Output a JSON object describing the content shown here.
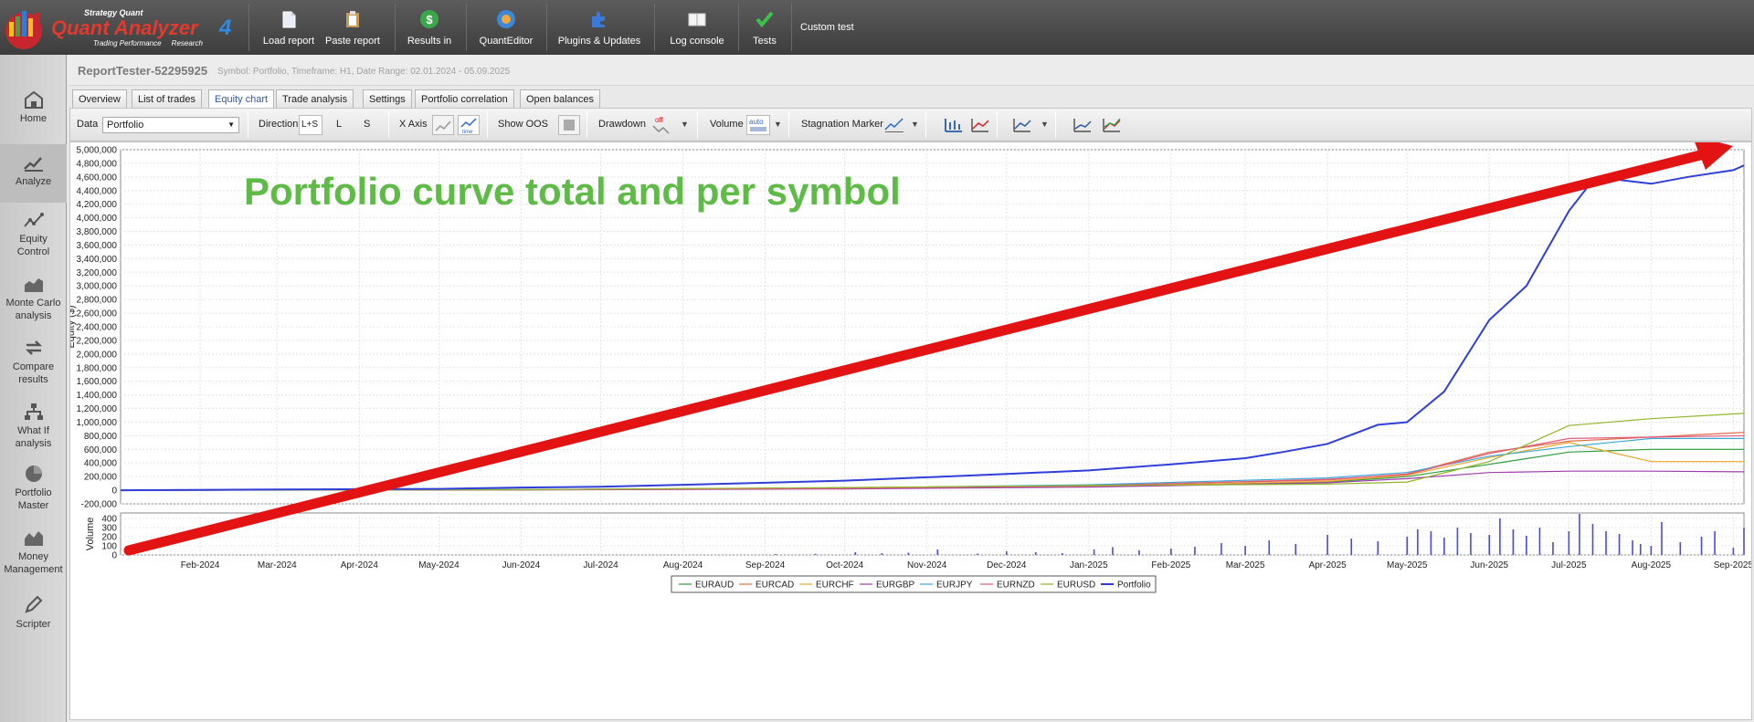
{
  "app": {
    "brand_small": "Strategy Quant",
    "brand_name": "Quant Analyzer",
    "brand_version": "4",
    "brand_tagline": "Trading Performance     Research"
  },
  "toolbar": {
    "items": [
      {
        "label": "Load report",
        "icon": "load-report-icon"
      },
      {
        "label": "Paste report",
        "icon": "paste-report-icon"
      },
      {
        "label": "Results in",
        "icon": "results-in-icon"
      },
      {
        "label": "QuantEditor",
        "icon": "quanteditor-icon"
      },
      {
        "label": "Plugins & Updates",
        "icon": "plugins-icon"
      },
      {
        "label": "Log console",
        "icon": "log-console-icon"
      },
      {
        "label": "Tests",
        "icon": "check-icon"
      }
    ],
    "custom_test_label": "Custom test"
  },
  "sidebar": {
    "items": [
      {
        "label": "Home",
        "icon": "home-icon"
      },
      {
        "label": "Analyze",
        "icon": "analyze-icon"
      },
      {
        "label": "Equity Control",
        "icon": "equity-control-icon"
      },
      {
        "label": "Monte Carlo analysis",
        "icon": "monte-carlo-icon"
      },
      {
        "label": "Compare results",
        "icon": "compare-icon"
      },
      {
        "label": "What If analysis",
        "icon": "what-if-icon"
      },
      {
        "label": "Portfolio Master",
        "icon": "portfolio-master-icon"
      },
      {
        "label": "Money Management",
        "icon": "money-management-icon"
      },
      {
        "label": "Scripter",
        "icon": "scripter-icon"
      }
    ],
    "active": "Analyze"
  },
  "header": {
    "title": "ReportTester-52295925",
    "meta": "Symbol: Portfolio, Timeframe: H1, Date Range: 02.01.2024 - 05.09.2025"
  },
  "tabs": [
    "Overview",
    "List of trades",
    "Equity chart",
    "Trade analysis",
    "Settings",
    "Portfolio correlation",
    "Open balances"
  ],
  "active_tab": "Equity chart",
  "chart_toolbar": {
    "data_label": "Data",
    "data_value": "Portfolio",
    "direction_label": "Direction",
    "direction_options": [
      "L+S",
      "L",
      "S"
    ],
    "xaxis_label": "X Axis",
    "xaxis_time": "time",
    "show_oos_label": "Show OOS",
    "drawdown_label": "Drawdown",
    "drawdown_value": "off",
    "volume_label": "Volume",
    "volume_value": "auto",
    "stagnation_label": "Stagnation Marker"
  },
  "annotation": {
    "text": "Portfolio curve total and per symbol",
    "color": "#5dbb46",
    "arrow_color": "#e41313"
  },
  "chart_data": {
    "type": "line",
    "ylabel": "Equity ($)",
    "y_ticks": [
      5000000,
      4800000,
      4600000,
      4400000,
      4200000,
      4000000,
      3800000,
      3600000,
      3400000,
      3200000,
      3000000,
      2800000,
      2600000,
      2400000,
      2200000,
      2000000,
      1800000,
      1600000,
      1400000,
      1200000,
      1000000,
      800000,
      600000,
      400000,
      200000,
      0,
      -200000
    ],
    "y_tick_labels": [
      "5,000,000",
      "4,800,000",
      "4,600,000",
      "4,400,000",
      "4,200,000",
      "4,000,000",
      "3,800,000",
      "3,600,000",
      "3,400,000",
      "3,200,000",
      "3,000,000",
      "2,800,000",
      "2,600,000",
      "2,400,000",
      "2,200,000",
      "2,000,000",
      "1,800,000",
      "1,600,000",
      "1,400,000",
      "1,200,000",
      "1,000,000",
      "800,000",
      "600,000",
      "400,000",
      "200,000",
      "0",
      "-200,000"
    ],
    "ylim": [
      -200000,
      5000000
    ],
    "x_range": [
      "2024-01-02",
      "2025-09-05"
    ],
    "x_ticks": [
      {
        "date": "2024-02-01",
        "label": "Feb-2024"
      },
      {
        "date": "2024-03-01",
        "label": "Mar-2024"
      },
      {
        "date": "2024-04-01",
        "label": "Apr-2024"
      },
      {
        "date": "2024-05-01",
        "label": "May-2024"
      },
      {
        "date": "2024-06-01",
        "label": "Jun-2024"
      },
      {
        "date": "2024-07-01",
        "label": "Jul-2024"
      },
      {
        "date": "2024-08-01",
        "label": "Aug-2024"
      },
      {
        "date": "2024-09-01",
        "label": "Sep-2024"
      },
      {
        "date": "2024-10-01",
        "label": "Oct-2024"
      },
      {
        "date": "2024-11-01",
        "label": "Nov-2024"
      },
      {
        "date": "2024-12-01",
        "label": "Dec-2024"
      },
      {
        "date": "2025-01-01",
        "label": "Jan-2025"
      },
      {
        "date": "2025-02-01",
        "label": "Feb-2025"
      },
      {
        "date": "2025-03-01",
        "label": "Mar-2025"
      },
      {
        "date": "2025-04-01",
        "label": "Apr-2025"
      },
      {
        "date": "2025-05-01",
        "label": "May-2025"
      },
      {
        "date": "2025-06-01",
        "label": "Jun-2025"
      },
      {
        "date": "2025-07-01",
        "label": "Jul-2025"
      },
      {
        "date": "2025-08-01",
        "label": "Aug-2025"
      },
      {
        "date": "2025-09-01",
        "label": "Sep-2025"
      }
    ],
    "grid": true,
    "legend_position": "bottom-center",
    "series": [
      {
        "name": "EURAUD",
        "color": "#2e9c3a",
        "points": [
          [
            "2024-01-02",
            0
          ],
          [
            "2024-06-01",
            8000
          ],
          [
            "2024-10-01",
            30000
          ],
          [
            "2025-01-01",
            60000
          ],
          [
            "2025-04-01",
            120000
          ],
          [
            "2025-05-01",
            200000
          ],
          [
            "2025-06-01",
            380000
          ],
          [
            "2025-07-01",
            560000
          ],
          [
            "2025-08-01",
            600000
          ],
          [
            "2025-09-05",
            600000
          ]
        ]
      },
      {
        "name": "EURCAD",
        "color": "#e06a4a",
        "points": [
          [
            "2024-01-02",
            0
          ],
          [
            "2024-06-01",
            10000
          ],
          [
            "2024-10-01",
            35000
          ],
          [
            "2025-01-01",
            70000
          ],
          [
            "2025-04-01",
            150000
          ],
          [
            "2025-05-01",
            240000
          ],
          [
            "2025-06-01",
            560000
          ],
          [
            "2025-07-01",
            720000
          ],
          [
            "2025-08-01",
            780000
          ],
          [
            "2025-09-05",
            850000
          ]
        ]
      },
      {
        "name": "EURCHF",
        "color": "#e8a72a",
        "points": [
          [
            "2024-01-02",
            0
          ],
          [
            "2024-06-01",
            6000
          ],
          [
            "2024-10-01",
            25000
          ],
          [
            "2025-01-01",
            55000
          ],
          [
            "2025-04-01",
            130000
          ],
          [
            "2025-05-01",
            220000
          ],
          [
            "2025-06-01",
            480000
          ],
          [
            "2025-07-01",
            700000
          ],
          [
            "2025-08-01",
            420000
          ],
          [
            "2025-09-05",
            420000
          ]
        ]
      },
      {
        "name": "EURGBP",
        "color": "#a03cb0",
        "points": [
          [
            "2024-01-02",
            0
          ],
          [
            "2024-06-01",
            5000
          ],
          [
            "2024-10-01",
            20000
          ],
          [
            "2025-01-01",
            45000
          ],
          [
            "2025-04-01",
            110000
          ],
          [
            "2025-05-01",
            170000
          ],
          [
            "2025-06-01",
            260000
          ],
          [
            "2025-07-01",
            280000
          ],
          [
            "2025-08-01",
            280000
          ],
          [
            "2025-09-05",
            270000
          ]
        ]
      },
      {
        "name": "EURJPY",
        "color": "#3aa6d8",
        "points": [
          [
            "2024-01-02",
            0
          ],
          [
            "2024-06-01",
            9000
          ],
          [
            "2024-10-01",
            30000
          ],
          [
            "2025-01-01",
            80000
          ],
          [
            "2025-04-01",
            180000
          ],
          [
            "2025-05-01",
            260000
          ],
          [
            "2025-06-01",
            500000
          ],
          [
            "2025-07-01",
            640000
          ],
          [
            "2025-08-01",
            760000
          ],
          [
            "2025-09-05",
            760000
          ]
        ]
      },
      {
        "name": "EURNZD",
        "color": "#e35a7a",
        "points": [
          [
            "2024-01-02",
            0
          ],
          [
            "2024-06-01",
            7000
          ],
          [
            "2024-10-01",
            28000
          ],
          [
            "2025-01-01",
            65000
          ],
          [
            "2025-04-01",
            160000
          ],
          [
            "2025-05-01",
            230000
          ],
          [
            "2025-06-01",
            540000
          ],
          [
            "2025-07-01",
            760000
          ],
          [
            "2025-08-01",
            780000
          ],
          [
            "2025-09-05",
            800000
          ]
        ]
      },
      {
        "name": "EURUSD",
        "color": "#8fb52a",
        "points": [
          [
            "2024-01-02",
            0
          ],
          [
            "2024-06-01",
            8000
          ],
          [
            "2024-10-01",
            40000
          ],
          [
            "2025-01-01",
            70000
          ],
          [
            "2025-04-01",
            90000
          ],
          [
            "2025-05-01",
            120000
          ],
          [
            "2025-06-01",
            420000
          ],
          [
            "2025-07-01",
            950000
          ],
          [
            "2025-08-01",
            1050000
          ],
          [
            "2025-09-05",
            1130000
          ]
        ]
      },
      {
        "name": "Portfolio",
        "color": "#2f3fd8",
        "points": [
          [
            "2024-01-02",
            0
          ],
          [
            "2024-03-01",
            10000
          ],
          [
            "2024-05-01",
            20000
          ],
          [
            "2024-06-01",
            40000
          ],
          [
            "2024-07-01",
            50000
          ],
          [
            "2024-08-01",
            80000
          ],
          [
            "2024-09-01",
            110000
          ],
          [
            "2024-10-01",
            140000
          ],
          [
            "2024-11-01",
            190000
          ],
          [
            "2024-12-01",
            240000
          ],
          [
            "2025-01-01",
            290000
          ],
          [
            "2025-02-01",
            380000
          ],
          [
            "2025-03-01",
            470000
          ],
          [
            "2025-03-15",
            560000
          ],
          [
            "2025-04-01",
            680000
          ],
          [
            "2025-04-20",
            960000
          ],
          [
            "2025-05-01",
            1000000
          ],
          [
            "2025-05-15",
            1450000
          ],
          [
            "2025-06-01",
            2500000
          ],
          [
            "2025-06-15",
            3000000
          ],
          [
            "2025-07-01",
            4100000
          ],
          [
            "2025-07-08",
            4450000
          ],
          [
            "2025-07-15",
            4580000
          ],
          [
            "2025-08-01",
            4500000
          ],
          [
            "2025-08-15",
            4600000
          ],
          [
            "2025-09-01",
            4700000
          ],
          [
            "2025-09-05",
            4770000
          ]
        ]
      }
    ],
    "volume": {
      "ylabel": "Volume",
      "y_ticks": [
        0,
        100,
        200,
        300,
        400
      ],
      "ylim": [
        0,
        460
      ],
      "color": "#4a4ae0",
      "bars": [
        [
          "2024-09-05",
          10
        ],
        [
          "2024-09-20",
          12
        ],
        [
          "2024-10-05",
          30
        ],
        [
          "2024-10-15",
          20
        ],
        [
          "2024-10-25",
          25
        ],
        [
          "2024-11-05",
          60
        ],
        [
          "2024-11-20",
          15
        ],
        [
          "2024-12-01",
          40
        ],
        [
          "2024-12-12",
          30
        ],
        [
          "2024-12-22",
          20
        ],
        [
          "2025-01-03",
          60
        ],
        [
          "2025-01-10",
          85
        ],
        [
          "2025-01-20",
          50
        ],
        [
          "2025-02-01",
          70
        ],
        [
          "2025-02-10",
          90
        ],
        [
          "2025-02-20",
          130
        ],
        [
          "2025-03-01",
          100
        ],
        [
          "2025-03-10",
          160
        ],
        [
          "2025-03-20",
          120
        ],
        [
          "2025-04-01",
          220
        ],
        [
          "2025-04-10",
          180
        ],
        [
          "2025-04-20",
          150
        ],
        [
          "2025-05-01",
          200
        ],
        [
          "2025-05-05",
          280
        ],
        [
          "2025-05-10",
          260
        ],
        [
          "2025-05-15",
          190
        ],
        [
          "2025-05-20",
          300
        ],
        [
          "2025-05-25",
          240
        ],
        [
          "2025-06-01",
          220
        ],
        [
          "2025-06-05",
          400
        ],
        [
          "2025-06-10",
          280
        ],
        [
          "2025-06-15",
          210
        ],
        [
          "2025-06-20",
          300
        ],
        [
          "2025-06-25",
          140
        ],
        [
          "2025-07-01",
          260
        ],
        [
          "2025-07-05",
          450
        ],
        [
          "2025-07-10",
          340
        ],
        [
          "2025-07-15",
          260
        ],
        [
          "2025-07-20",
          230
        ],
        [
          "2025-07-25",
          160
        ],
        [
          "2025-07-28",
          120
        ],
        [
          "2025-08-01",
          100
        ],
        [
          "2025-08-05",
          360
        ],
        [
          "2025-08-12",
          140
        ],
        [
          "2025-08-20",
          200
        ],
        [
          "2025-08-25",
          260
        ],
        [
          "2025-09-01",
          80
        ],
        [
          "2025-09-05",
          300
        ]
      ]
    }
  }
}
